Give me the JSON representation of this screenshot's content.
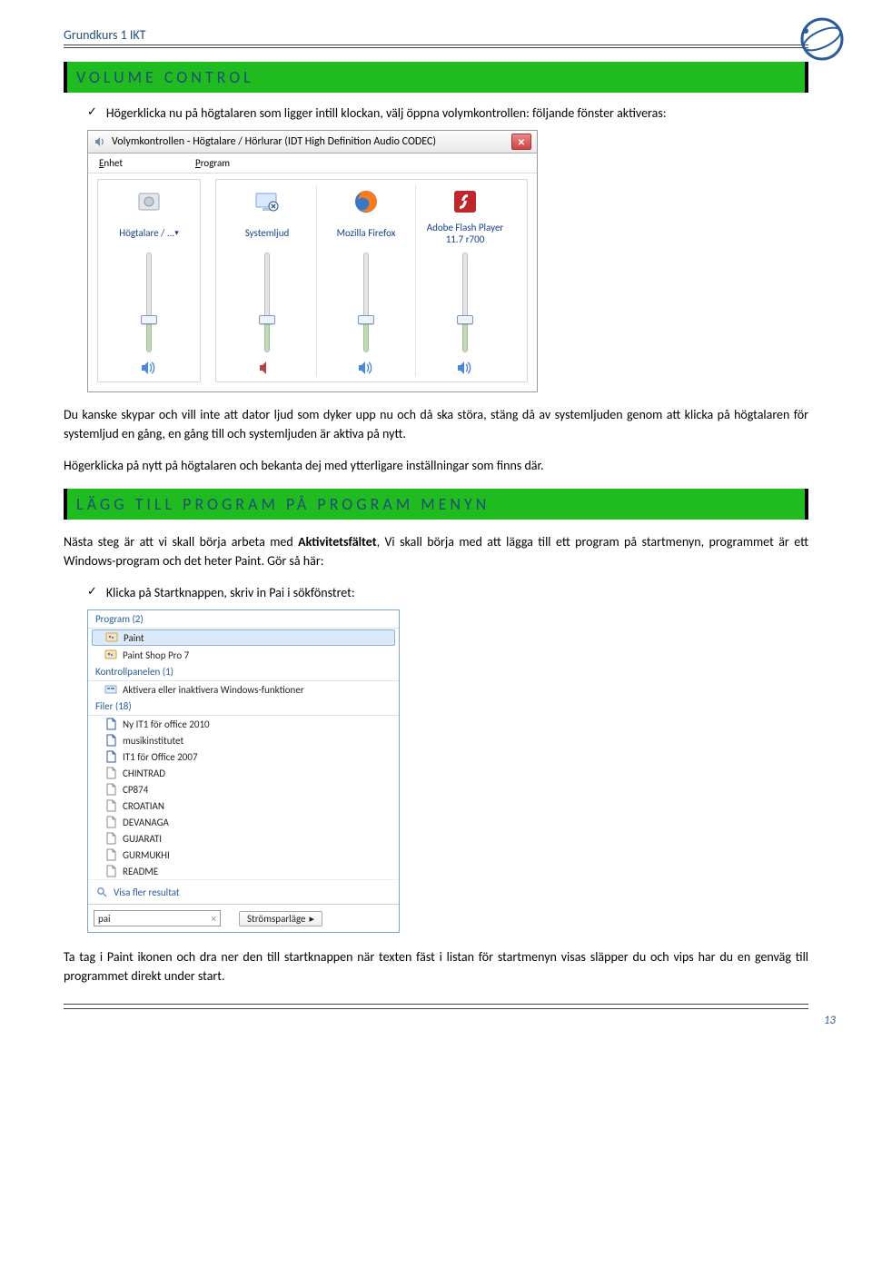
{
  "header": {
    "title": "Grundkurs 1 IKT"
  },
  "headings": {
    "volume_control": "VOLUME CONTROL",
    "add_program": "LÄGG TILL PROGRAM PÅ PROGRAM MENYN"
  },
  "items": {
    "check1": "Högerklicka nu på högtalaren som ligger intill klockan, välj öppna volymkontrollen: följande fönster aktiveras:",
    "p_after_mixer": "Du kanske skypar och vill inte att dator ljud som dyker upp nu och då ska störa, stäng då av systemljuden genom att klicka på högtalaren för systemljud en gång, en gång till och systemljuden är aktiva på nytt.",
    "p_after_mixer2": "Högerklicka på nytt på högtalaren och bekanta dej med ytterligare inställningar som finns där.",
    "p_prog_intro_a": "Nästa steg är att vi skall börja arbeta med ",
    "p_prog_intro_bold": "Aktivitetsfältet",
    "p_prog_intro_b": ", Vi skall börja med att lägga till ett program på startmenyn, programmet är ett Windows-program och det heter Paint. Gör så här:",
    "check2": "Klicka på Startknappen, skriv in Pai i sökfönstret:",
    "p_footer": "Ta tag i Paint ikonen och dra ner den till startknappen när texten fäst i listan för startmenyn visas släpper du och vips har du en genväg till programmet direkt under start."
  },
  "mixer": {
    "title": "Volymkontrollen - Högtalare / Hörlurar (IDT High Definition Audio CODEC)",
    "menu_device": "Enhet",
    "menu_program": "Program",
    "cols": [
      {
        "label": "Högtalare / ...",
        "drop": true,
        "level": 28,
        "muted": false,
        "main": true
      },
      {
        "label": "Systemljud",
        "drop": false,
        "level": 28,
        "muted": true,
        "main": false
      },
      {
        "label": "Mozilla Firefox",
        "drop": false,
        "level": 28,
        "muted": false,
        "main": false
      },
      {
        "label": "Adobe Flash Player 11.7 r700",
        "drop": false,
        "level": 28,
        "muted": false,
        "main": false
      }
    ]
  },
  "startmenu": {
    "cat_program": "Program (2)",
    "prog": [
      {
        "name": "Paint",
        "sel": true
      },
      {
        "name": "Paint Shop Pro 7",
        "sel": false
      }
    ],
    "cat_cpl": "Kontrollpanelen (1)",
    "cpl": [
      {
        "name": "Aktivera eller inaktivera Windows-funktioner"
      }
    ],
    "cat_files": "Filer (18)",
    "files": [
      "Ny IT1 för office 2010",
      "musikinstitutet",
      "IT1 för Office 2007",
      "CHINTRAD",
      "CP874",
      "CROATIAN",
      "DEVANAGA",
      "GUJARATI",
      "GURMUKHI",
      "README"
    ],
    "visa": "Visa fler resultat",
    "search_value": "pai",
    "shutdown": "Strömsparläge"
  },
  "page_number": "13"
}
